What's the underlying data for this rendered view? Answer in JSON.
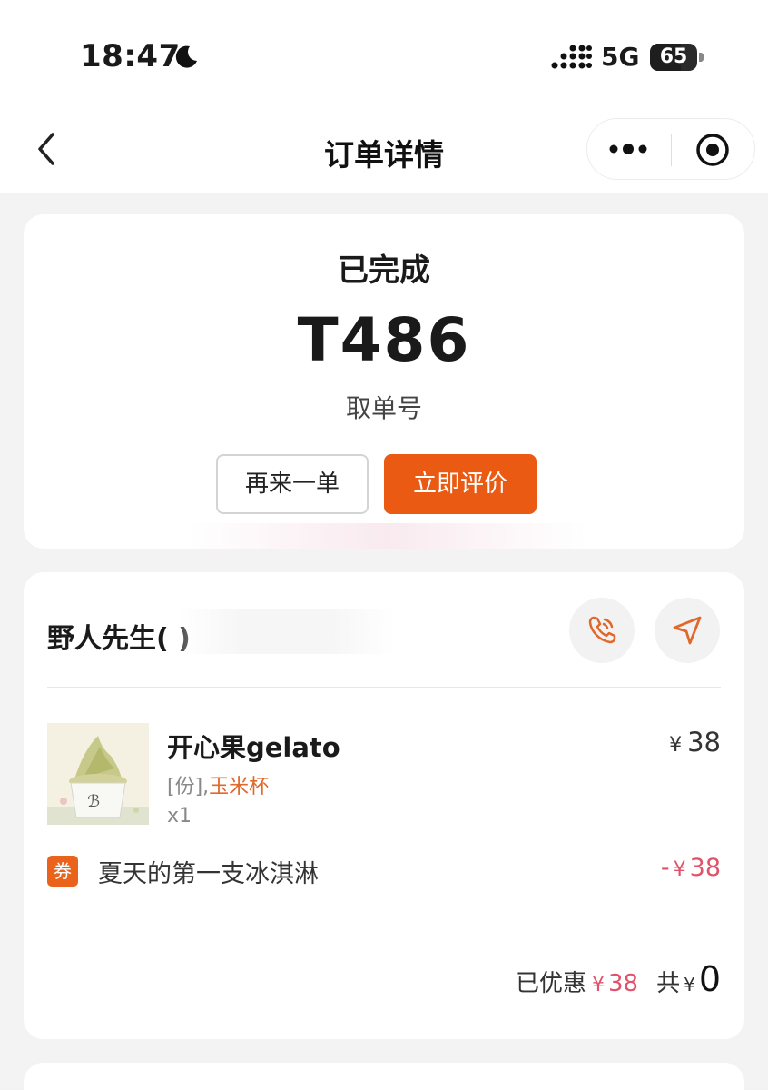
{
  "status_bar": {
    "time": "18:47",
    "network": "5G",
    "battery_percent": 65,
    "battery_label": "65"
  },
  "nav": {
    "title": "订单详情"
  },
  "order_status": {
    "status": "已完成",
    "pickup_code": "T486",
    "pickup_label": "取单号",
    "reorder_label": "再来一单",
    "review_label": "立即评价"
  },
  "store": {
    "name": "野人先生(     )"
  },
  "items": [
    {
      "name": "开心果gelato",
      "spec_prefix": "[份],",
      "spec_option": "玉米杯",
      "quantity": "x1",
      "currency": "¥",
      "price": "38"
    }
  ],
  "coupon": {
    "badge": "券",
    "name": "夏天的第一支冰淇淋",
    "sign": "-",
    "currency": "¥",
    "amount": "38"
  },
  "summary": {
    "saved_label": "已优惠",
    "saved_currency": "¥",
    "saved_amount": "38",
    "total_label": "共",
    "total_currency": "¥",
    "total_amount": "0"
  },
  "colors": {
    "accent": "#ea5a13",
    "discount": "#e0526a",
    "background": "#f3f3f3"
  }
}
